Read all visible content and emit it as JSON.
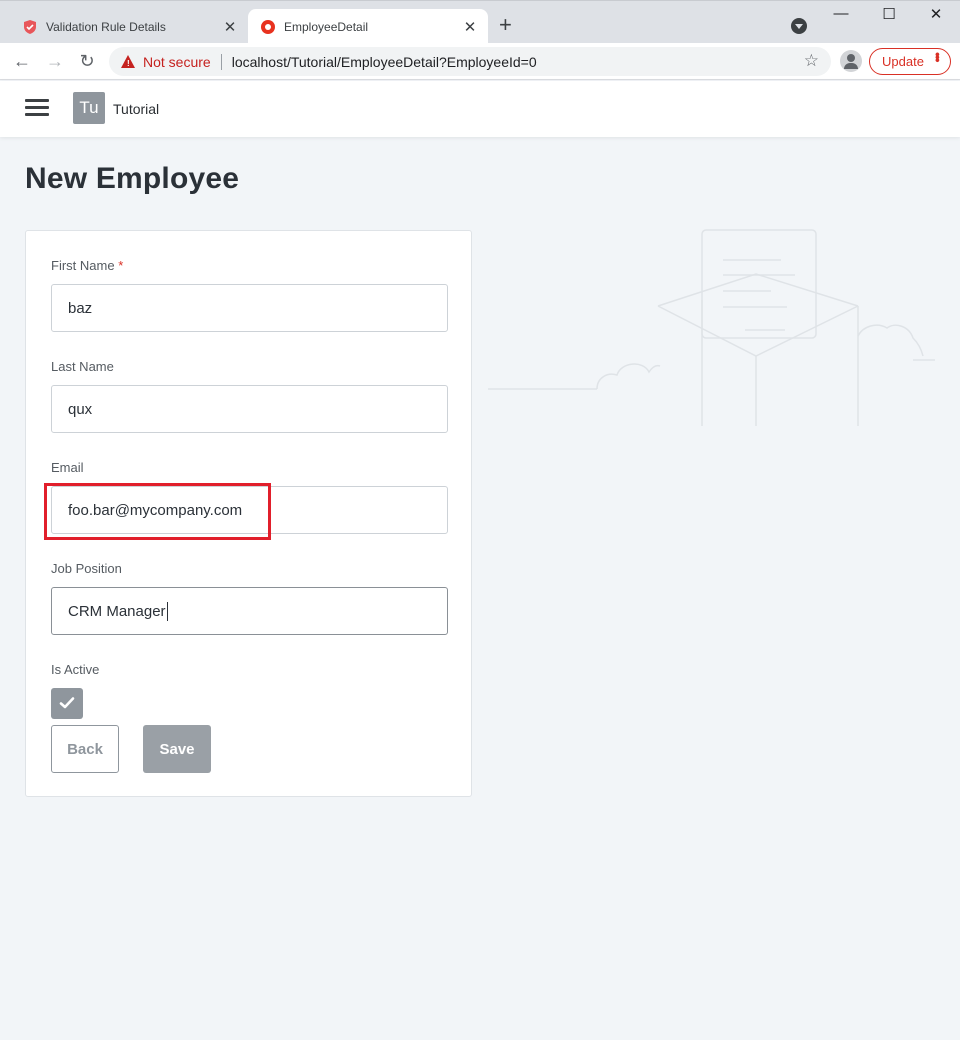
{
  "browser": {
    "tabs": [
      {
        "title": "Validation Rule Details",
        "active": false,
        "favicon": "shield-icon"
      },
      {
        "title": "EmployeeDetail",
        "active": true,
        "favicon": "record-icon"
      }
    ],
    "new_tab": "+",
    "address": {
      "security_label": "Not secure",
      "url": "localhost/Tutorial/EmployeeDetail?EmployeeId=0"
    },
    "update_label": "Update",
    "colors": {
      "warning": "#c5221f",
      "update": "#d93025"
    }
  },
  "app": {
    "logo_text": "Tu",
    "name": "Tutorial"
  },
  "page": {
    "title": "New Employee"
  },
  "form": {
    "first_name": {
      "label": "First Name",
      "required_mark": "*",
      "value": "baz"
    },
    "last_name": {
      "label": "Last Name",
      "value": "qux"
    },
    "email": {
      "label": "Email",
      "value": "foo.bar@mycompany.com"
    },
    "job_position": {
      "label": "Job Position",
      "value": "CRM Manager"
    },
    "is_active": {
      "label": "Is Active",
      "checked": true
    },
    "back_label": "Back",
    "save_label": "Save"
  },
  "annotation": {
    "highlight_color": "#e11f2b",
    "target": "email-input"
  }
}
